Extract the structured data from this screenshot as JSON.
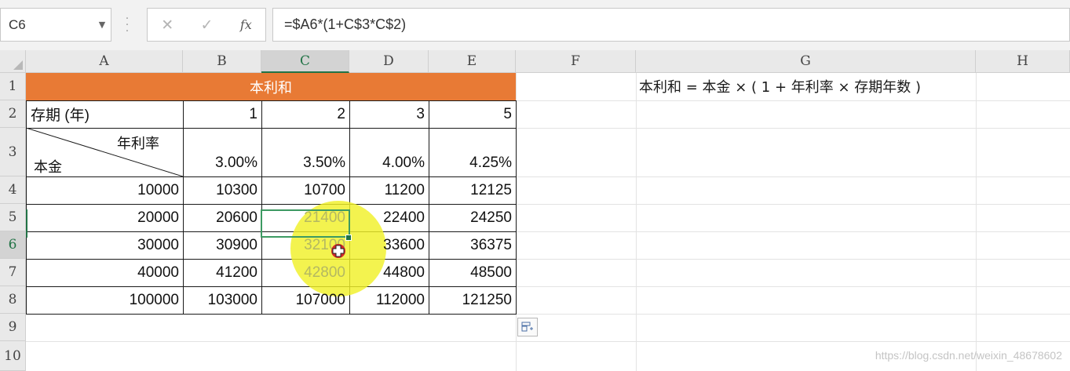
{
  "name_box": {
    "value": "C6"
  },
  "formula_bar": {
    "cancel_glyph": "✕",
    "enter_glyph": "✓",
    "fx_label": "fx",
    "formula": "=$A6*(1+C$3*C$2)"
  },
  "columns": [
    "A",
    "B",
    "C",
    "D",
    "E",
    "F",
    "G",
    "H"
  ],
  "rows": [
    "1",
    "2",
    "3",
    "4",
    "5",
    "6",
    "7",
    "8",
    "9",
    "10"
  ],
  "selected_column": "C",
  "selected_row": "6",
  "sheet": {
    "title": "本利和",
    "header_label": "存期 (年)",
    "periods": [
      "1",
      "2",
      "3",
      "5"
    ],
    "diag_top_label": "年利率",
    "diag_bottom_label": "本金",
    "rates": [
      "3.00%",
      "3.50%",
      "4.00%",
      "4.25%"
    ],
    "principals": [
      "10000",
      "20000",
      "30000",
      "40000",
      "100000"
    ],
    "values": [
      [
        "10300",
        "10700",
        "11200",
        "12125"
      ],
      [
        "20600",
        "21400",
        "22400",
        "24250"
      ],
      [
        "30900",
        "32100",
        "33600",
        "36375"
      ],
      [
        "41200",
        "42800",
        "44800",
        "48500"
      ],
      [
        "103000",
        "107000",
        "112000",
        "121250"
      ]
    ],
    "formula_note": "本利和 = 本金 × ( 1 + 年利率 × 存期年数 )"
  },
  "watermark": "https://blog.csdn.net/weixin_48678602",
  "colors": {
    "title_band": "#e87a35",
    "selection": "#217346",
    "cursor_highlight": "#f0f028"
  }
}
